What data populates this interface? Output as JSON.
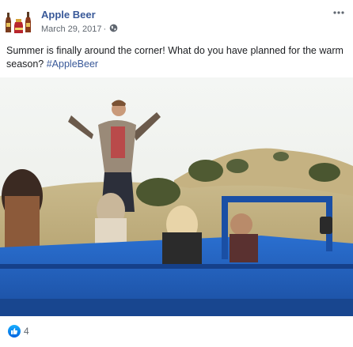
{
  "post": {
    "page_name": "Apple Beer",
    "date": "March 29, 2017",
    "caption_text": "Summer is finally around the corner! What do you have planned for the warm season? ",
    "hashtag": "#AppleBeer",
    "reaction_count": "4"
  },
  "icons": {
    "privacy": "globe-icon",
    "menu": "more-options-icon",
    "reaction": "like-icon"
  },
  "colors": {
    "link_blue": "#385898",
    "secondary_text": "#606770",
    "jeep_blue": "#1f5ec4"
  }
}
